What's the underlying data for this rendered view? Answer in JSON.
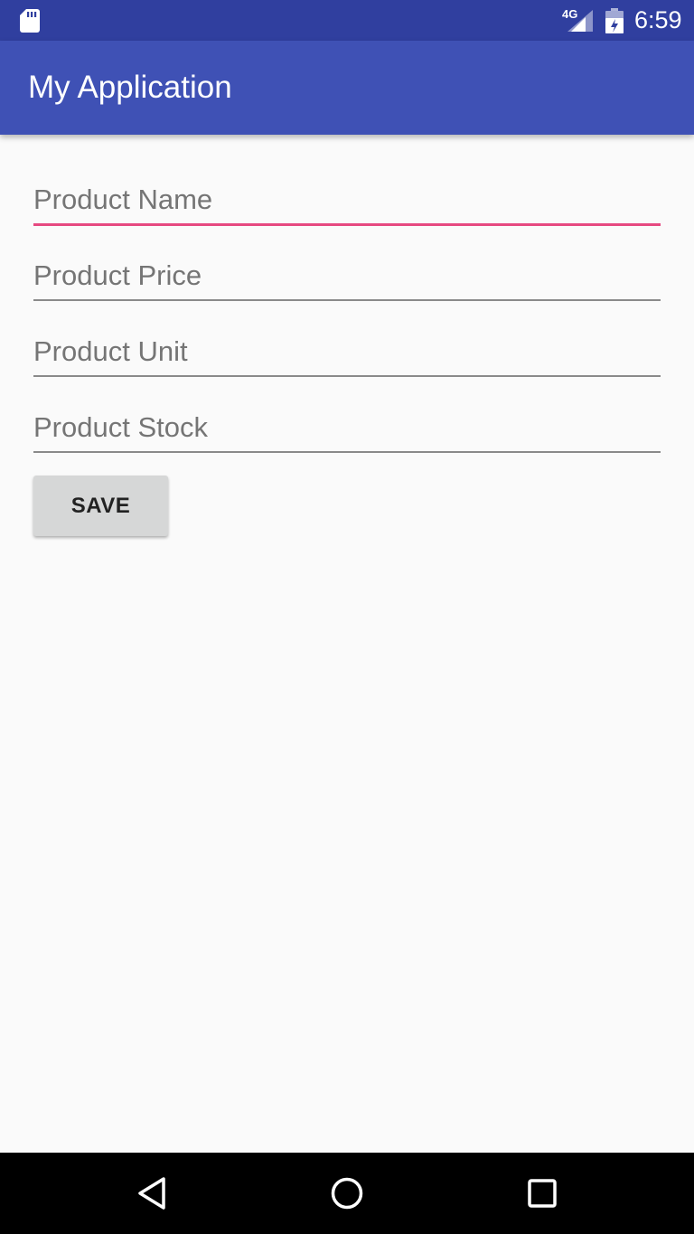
{
  "status_bar": {
    "network": "4G",
    "time": "6:59"
  },
  "app_bar": {
    "title": "My Application"
  },
  "form": {
    "product_name": {
      "placeholder": "Product Name",
      "value": ""
    },
    "product_price": {
      "placeholder": "Product Price",
      "value": ""
    },
    "product_unit": {
      "placeholder": "Product Unit",
      "value": ""
    },
    "product_stock": {
      "placeholder": "Product Stock",
      "value": ""
    },
    "save_label": "SAVE"
  },
  "colors": {
    "status_bar": "#303f9f",
    "app_bar": "#3f51b5",
    "focus_accent": "#e64980",
    "background": "#fafafa"
  },
  "icons": {
    "status": [
      "sd-card-icon",
      "signal-icon",
      "battery-icon"
    ],
    "navigation": [
      "back-icon",
      "home-icon",
      "recents-icon"
    ]
  }
}
